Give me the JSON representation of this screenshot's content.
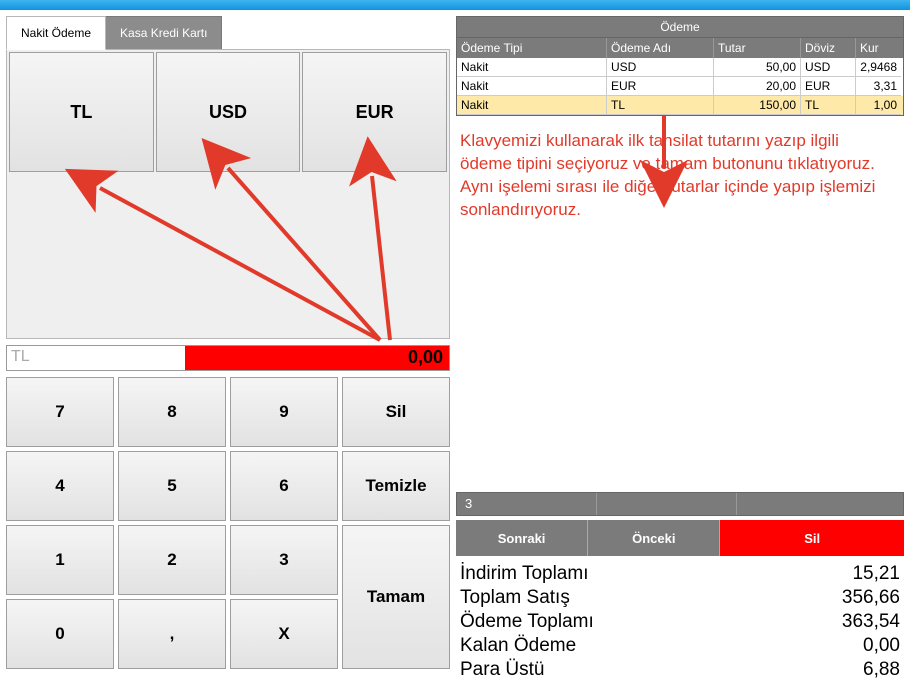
{
  "tabs": {
    "cash": "Nakit Ödeme",
    "card": "Kasa Kredi Kartı"
  },
  "currency": {
    "tl": "TL",
    "usd": "USD",
    "eur": "EUR"
  },
  "display": {
    "currency_label": "TL",
    "amount": "0,00"
  },
  "keys": {
    "k7": "7",
    "k8": "8",
    "k9": "9",
    "sil": "Sil",
    "k4": "4",
    "k5": "5",
    "k6": "6",
    "temizle": "Temizle",
    "k1": "1",
    "k2": "2",
    "k3": "3",
    "tamam": "Tamam",
    "k0": "0",
    "comma": ",",
    "x": "X"
  },
  "payment": {
    "title": "Ödeme",
    "headers": {
      "type": "Ödeme Tipi",
      "name": "Ödeme Adı",
      "amount": "Tutar",
      "currency": "Döviz",
      "rate": "Kur"
    },
    "rows": [
      {
        "type": "Nakit",
        "name": "USD",
        "amount": "50,00",
        "currency": "USD",
        "rate": "2,9468"
      },
      {
        "type": "Nakit",
        "name": "EUR",
        "amount": "20,00",
        "currency": "EUR",
        "rate": "3,31"
      },
      {
        "type": "Nakit",
        "name": "TL",
        "amount": "150,00",
        "currency": "TL",
        "rate": "1,00"
      }
    ],
    "count": "3"
  },
  "annotation": "Klavyemizi kullanarak ilk tahsilat tutarını yazıp ilgili ödeme tipini seçiyoruz ve tamam butonunu tıklatıyoruz. Aynı işelemi sırası ile diğer tutarlar içinde yapıp işlemizi sonlandırıyoruz.",
  "nav": {
    "next": "Sonraki",
    "prev": "Önceki",
    "del": "Sil"
  },
  "totals": {
    "items": [
      {
        "label": "İndirim Toplamı",
        "value": "15,21"
      },
      {
        "label": "Toplam Satış",
        "value": "356,66"
      },
      {
        "label": "Ödeme Toplamı",
        "value": "363,54"
      },
      {
        "label": "Kalan Ödeme",
        "value": "0,00"
      },
      {
        "label": "Para Üstü",
        "value": "6,88"
      }
    ]
  },
  "colors": {
    "accent_red": "#ff0000",
    "header_gray": "#7b7b7b",
    "annotation_red": "#e23a2a"
  }
}
